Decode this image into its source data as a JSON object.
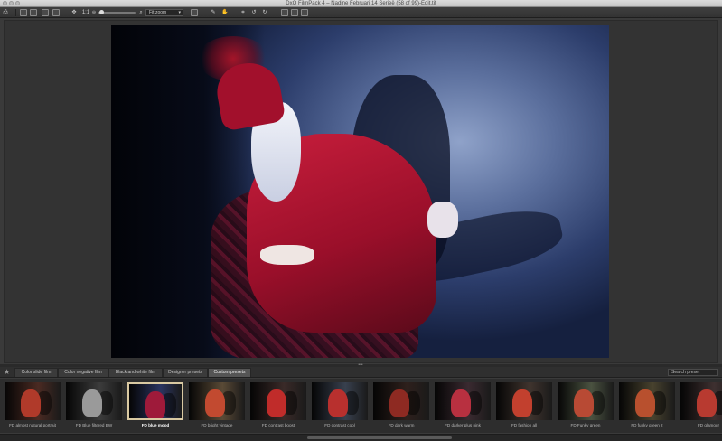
{
  "window": {
    "title": "DxO FilmPack 4 – Nadine Februari 14 Serieë (58 of 99)-Edit.tif"
  },
  "toolbar": {
    "zoom_one_to_one": "1:1",
    "zoom_mode": "Fit zoom"
  },
  "tabs": [
    {
      "label": "Color slide film"
    },
    {
      "label": "Color negative film"
    },
    {
      "label": "Black and white film"
    },
    {
      "label": "Designer presets"
    },
    {
      "label": "Custom presets",
      "active": true
    }
  ],
  "search": {
    "placeholder": "Search preset"
  },
  "presets": [
    {
      "label": "FD almost natural portrait",
      "tint": "#4a2a22",
      "fig": "#b03a2a"
    },
    {
      "label": "FD Blue filtered BW",
      "tint": "#3c3c3c",
      "fig": "#9a9a9a"
    },
    {
      "label": "FD blue mood",
      "tint": "#2a3460",
      "fig": "#9e1a3a",
      "selected": true
    },
    {
      "label": "FD bright vintage",
      "tint": "#5a4a36",
      "fig": "#c24a30"
    },
    {
      "label": "FD contrast boost",
      "tint": "#3a2a28",
      "fig": "#c02c2a"
    },
    {
      "label": "FD contrast cool",
      "tint": "#38404e",
      "fig": "#b8302e"
    },
    {
      "label": "FD dark warm",
      "tint": "#2e201c",
      "fig": "#8e2a22"
    },
    {
      "label": "FD darker plus pink",
      "tint": "#3a2a30",
      "fig": "#b83040"
    },
    {
      "label": "FD fashion all",
      "tint": "#40342e",
      "fig": "#c2402e"
    },
    {
      "label": "FD Funky green",
      "tint": "#4a5240",
      "fig": "#b84a34"
    },
    {
      "label": "FD funky green 2",
      "tint": "#48422e",
      "fig": "#b8502e"
    },
    {
      "label": "FD glamour",
      "tint": "#3e3030",
      "fig": "#b83a30"
    }
  ]
}
